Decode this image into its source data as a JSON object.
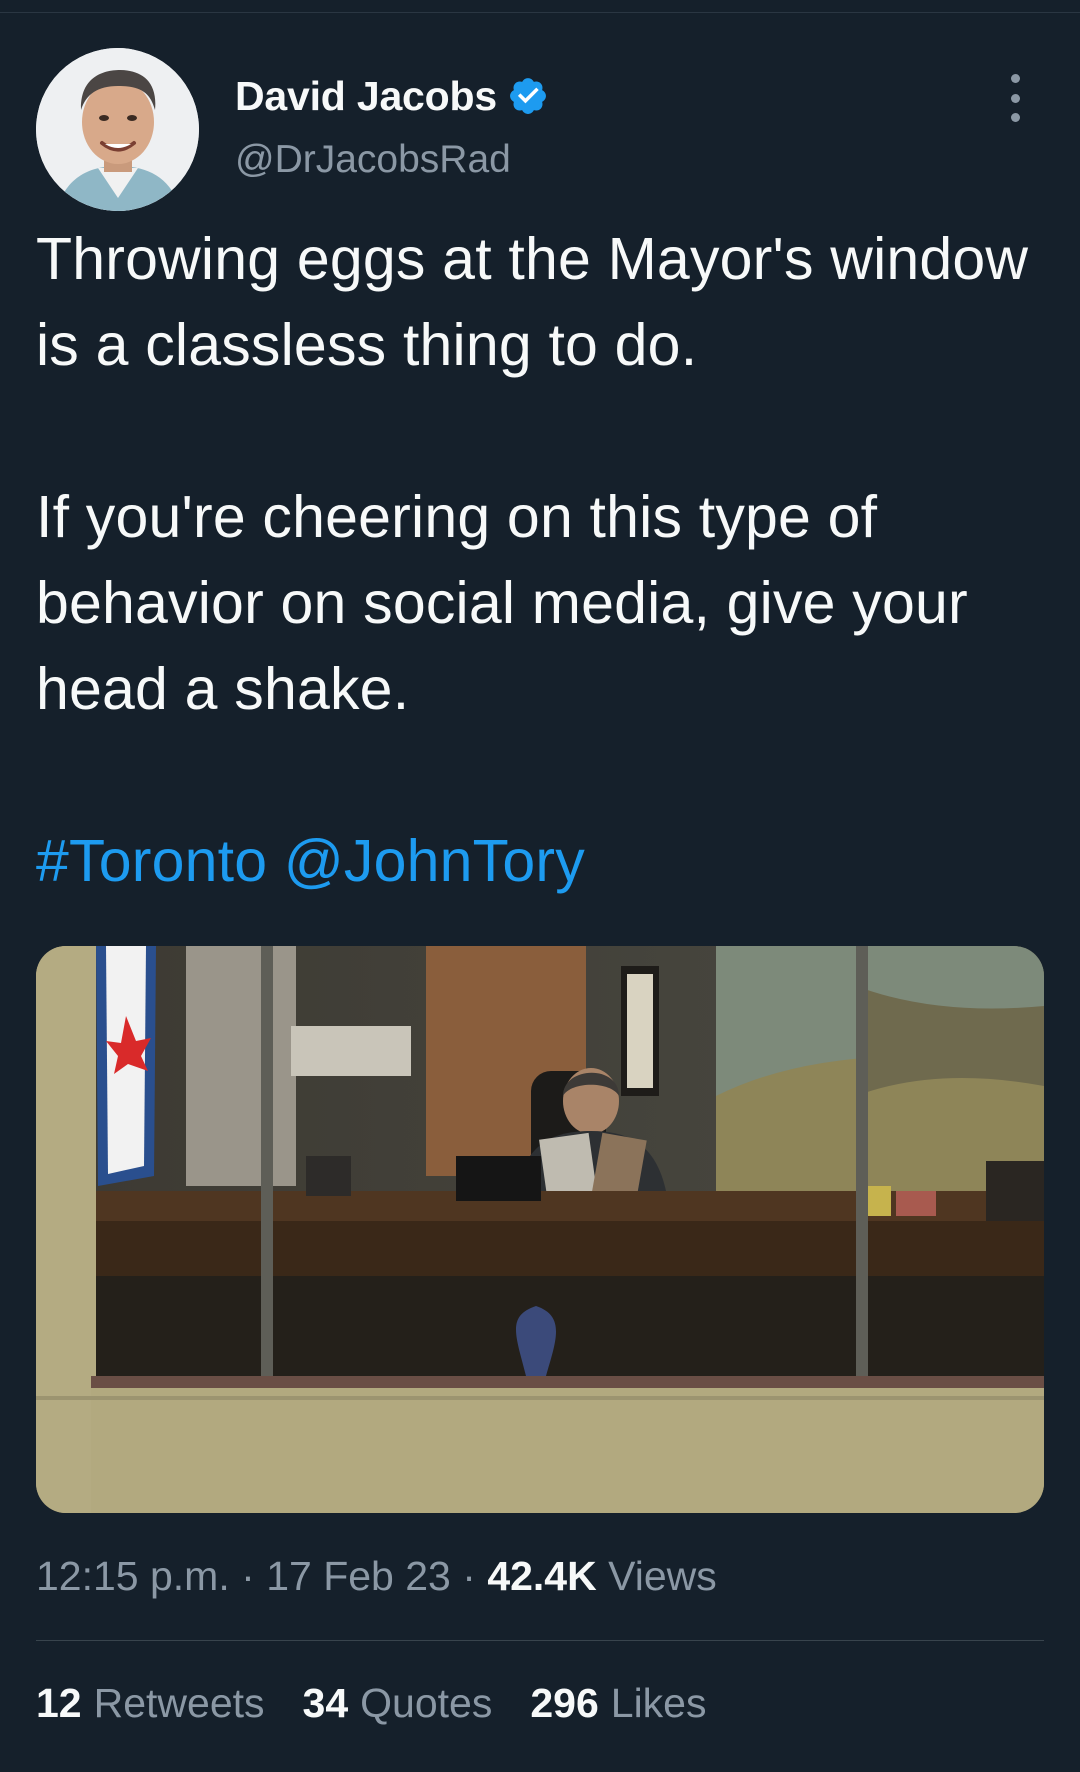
{
  "tweet": {
    "author": {
      "display_name": "David Jacobs",
      "handle": "@DrJacobsRad",
      "verified": true,
      "avatar_icon": "profile-photo"
    },
    "text": {
      "paragraph1": "Throwing eggs at the Mayor's window is a classless thing to do.",
      "paragraph2": "If you're cheering on this type of behavior on social media, give your head a shake.",
      "hashtag": "#Toronto",
      "mention": "@JohnTory"
    },
    "media": {
      "type": "photo"
    },
    "meta": {
      "time": "12:15 p.m.",
      "separator": "·",
      "date": "17 Feb 23",
      "views_count": "42.4K",
      "views_label": "Views"
    },
    "stats": {
      "retweets_count": "12",
      "retweets_label": "Retweets",
      "quotes_count": "34",
      "quotes_label": "Quotes",
      "likes_count": "296",
      "likes_label": "Likes"
    }
  },
  "colors": {
    "background": "#15202b",
    "text": "#f7f9f9",
    "secondary_text": "#8b98a5",
    "link": "#1d9bf0",
    "verified_badge": "#1d9bf0"
  },
  "icons": {
    "verified": "verified-badge-icon",
    "more": "more-options-icon"
  }
}
